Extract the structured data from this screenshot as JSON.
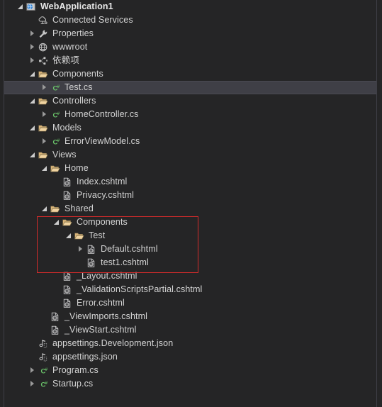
{
  "window": {
    "name": "solution-explorer-tree",
    "background": "#252526",
    "selection_color": "#3f3f46",
    "annotation_color": "#d42b2b",
    "text_color": "#d4d4d4"
  },
  "tree": {
    "nodes": [
      {
        "label": "WebApplication1",
        "depth": 0,
        "icon": "project-web-icon",
        "twisty": "expanded",
        "bold": true,
        "selected": false
      },
      {
        "label": "Connected Services",
        "depth": 1,
        "icon": "connected-services-icon",
        "twisty": "none",
        "bold": false,
        "selected": false
      },
      {
        "label": "Properties",
        "depth": 1,
        "icon": "wrench-icon",
        "twisty": "collapsed",
        "bold": false,
        "selected": false
      },
      {
        "label": "wwwroot",
        "depth": 1,
        "icon": "globe-icon",
        "twisty": "collapsed",
        "bold": false,
        "selected": false
      },
      {
        "label": "依赖项",
        "depth": 1,
        "icon": "dependencies-icon",
        "twisty": "collapsed",
        "bold": false,
        "selected": false
      },
      {
        "label": "Components",
        "depth": 1,
        "icon": "folder-open-icon",
        "twisty": "expanded",
        "bold": false,
        "selected": false
      },
      {
        "label": "Test.cs",
        "depth": 2,
        "icon": "csharp-file-icon",
        "twisty": "collapsed",
        "bold": false,
        "selected": true
      },
      {
        "label": "Controllers",
        "depth": 1,
        "icon": "folder-open-icon",
        "twisty": "expanded",
        "bold": false,
        "selected": false
      },
      {
        "label": "HomeController.cs",
        "depth": 2,
        "icon": "csharp-file-icon",
        "twisty": "collapsed",
        "bold": false,
        "selected": false
      },
      {
        "label": "Models",
        "depth": 1,
        "icon": "folder-open-icon",
        "twisty": "expanded",
        "bold": false,
        "selected": false
      },
      {
        "label": "ErrorViewModel.cs",
        "depth": 2,
        "icon": "csharp-file-icon",
        "twisty": "collapsed",
        "bold": false,
        "selected": false
      },
      {
        "label": "Views",
        "depth": 1,
        "icon": "folder-open-icon",
        "twisty": "expanded",
        "bold": false,
        "selected": false
      },
      {
        "label": "Home",
        "depth": 2,
        "icon": "folder-open-icon",
        "twisty": "expanded",
        "bold": false,
        "selected": false
      },
      {
        "label": "Index.cshtml",
        "depth": 3,
        "icon": "razor-file-icon",
        "twisty": "none",
        "bold": false,
        "selected": false
      },
      {
        "label": "Privacy.cshtml",
        "depth": 3,
        "icon": "razor-file-icon",
        "twisty": "none",
        "bold": false,
        "selected": false
      },
      {
        "label": "Shared",
        "depth": 2,
        "icon": "folder-open-icon",
        "twisty": "expanded",
        "bold": false,
        "selected": false
      },
      {
        "label": "Components",
        "depth": 3,
        "icon": "folder-open-icon",
        "twisty": "expanded",
        "bold": false,
        "selected": false
      },
      {
        "label": "Test",
        "depth": 4,
        "icon": "folder-open-icon",
        "twisty": "expanded",
        "bold": false,
        "selected": false
      },
      {
        "label": "Default.cshtml",
        "depth": 5,
        "icon": "razor-file-icon",
        "twisty": "collapsed",
        "bold": false,
        "selected": false
      },
      {
        "label": "test1.cshtml",
        "depth": 5,
        "icon": "razor-file-icon",
        "twisty": "none",
        "bold": false,
        "selected": false
      },
      {
        "label": "_Layout.cshtml",
        "depth": 3,
        "icon": "razor-file-icon",
        "twisty": "none",
        "bold": false,
        "selected": false
      },
      {
        "label": "_ValidationScriptsPartial.cshtml",
        "depth": 3,
        "icon": "razor-file-icon",
        "twisty": "none",
        "bold": false,
        "selected": false
      },
      {
        "label": "Error.cshtml",
        "depth": 3,
        "icon": "razor-file-icon",
        "twisty": "none",
        "bold": false,
        "selected": false
      },
      {
        "label": "_ViewImports.cshtml",
        "depth": 2,
        "icon": "razor-file-icon",
        "twisty": "none",
        "bold": false,
        "selected": false
      },
      {
        "label": "_ViewStart.cshtml",
        "depth": 2,
        "icon": "razor-file-icon",
        "twisty": "none",
        "bold": false,
        "selected": false
      },
      {
        "label": "appsettings.Development.json",
        "depth": 1,
        "icon": "json-file-icon",
        "twisty": "none",
        "bold": false,
        "selected": false
      },
      {
        "label": "appsettings.json",
        "depth": 1,
        "icon": "json-file-icon",
        "twisty": "none",
        "bold": false,
        "selected": false
      },
      {
        "label": "Program.cs",
        "depth": 1,
        "icon": "csharp-file-icon",
        "twisty": "collapsed",
        "bold": false,
        "selected": false
      },
      {
        "label": "Startup.cs",
        "depth": 1,
        "icon": "csharp-file-icon",
        "twisty": "collapsed",
        "bold": false,
        "selected": false
      }
    ]
  },
  "annotation": {
    "name": "red-highlight-rectangle",
    "covers": [
      "Components",
      "Test",
      "Default.cshtml",
      "test1.cshtml"
    ]
  }
}
